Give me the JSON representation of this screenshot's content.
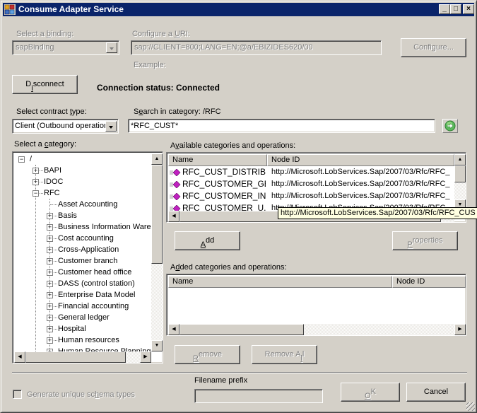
{
  "window": {
    "title": "Consume Adapter Service",
    "controls": {
      "minimize": "_",
      "maximize": "□",
      "close": "×"
    }
  },
  "binding": {
    "label": "Select a binding:",
    "label_accel": "b",
    "value": "sapBinding"
  },
  "uri": {
    "label": "Configure a URI:",
    "value": "sap://CLIENT=800;LANG=EN;@a/EBIZIDES620/00",
    "example_label": "Example:",
    "configure_button": "Configure..."
  },
  "connection": {
    "disconnect_button": "Disconnect",
    "status": "Connection status: Connected"
  },
  "contract": {
    "label": "Select contract type:",
    "value": "Client (Outbound operation:"
  },
  "search": {
    "label": "Search in category: /RFC",
    "value": "*RFC_CUST*",
    "go_icon": "go-arrow-icon"
  },
  "category_tree": {
    "label": "Select a category:",
    "root": "/",
    "level1": [
      {
        "label": "BAPI",
        "expander": "+"
      },
      {
        "label": "IDOC",
        "expander": "+"
      },
      {
        "label": "RFC",
        "expander": "−"
      }
    ],
    "rfc_children": [
      {
        "label": "Asset Accounting",
        "expander": ""
      },
      {
        "label": "Basis",
        "expander": "+"
      },
      {
        "label": "Business Information Wareh",
        "expander": "+"
      },
      {
        "label": "Cost accounting",
        "expander": "+"
      },
      {
        "label": "Cross-Application",
        "expander": "+"
      },
      {
        "label": "Customer branch",
        "expander": "+"
      },
      {
        "label": "Customer head office",
        "expander": "+"
      },
      {
        "label": "DASS (control station)",
        "expander": "+"
      },
      {
        "label": "Enterprise Data Model",
        "expander": "+"
      },
      {
        "label": "Financial accounting",
        "expander": "+"
      },
      {
        "label": "General ledger",
        "expander": "+"
      },
      {
        "label": "Hospital",
        "expander": "+"
      },
      {
        "label": "Human resources",
        "expander": "+"
      },
      {
        "label": "Human Resource Planning",
        "expander": "+"
      }
    ]
  },
  "available": {
    "label": "Available categories and operations:",
    "columns": [
      "Name",
      "Node ID"
    ],
    "rows": [
      {
        "name": "RFC_CUST_DISTRIB...",
        "node_id": "http://Microsoft.LobServices.Sap/2007/03/Rfc/RFC_"
      },
      {
        "name": "RFC_CUSTOMER_GET",
        "node_id": "http://Microsoft.LobServices.Sap/2007/03/Rfc/RFC_"
      },
      {
        "name": "RFC_CUSTOMER_IN...",
        "node_id": "http://Microsoft.LobServices.Sap/2007/03/Rfc/RFC_"
      },
      {
        "name": "RFC_CUSTOMER_U...",
        "node_id": "http://Microsoft.LobServices.Sap/2007/03/Rfc/RFC_"
      }
    ],
    "tooltip": "http://Microsoft.LobServices.Sap/2007/03/Rfc/RFC_CUS"
  },
  "actions": {
    "add_button": "Add",
    "properties_button": "Properties"
  },
  "added": {
    "label": "Added categories and operations:",
    "columns": [
      "Name",
      "Node ID"
    ],
    "rows": []
  },
  "remove": {
    "remove_button": "Remove",
    "remove_all_button": "Remove All"
  },
  "footer": {
    "checkbox_label": "Generate unique schema types",
    "checkbox_checked": false,
    "filename_prefix_label": "Filename prefix",
    "filename_prefix_value": "",
    "ok_button": "OK",
    "cancel_button": "Cancel"
  }
}
